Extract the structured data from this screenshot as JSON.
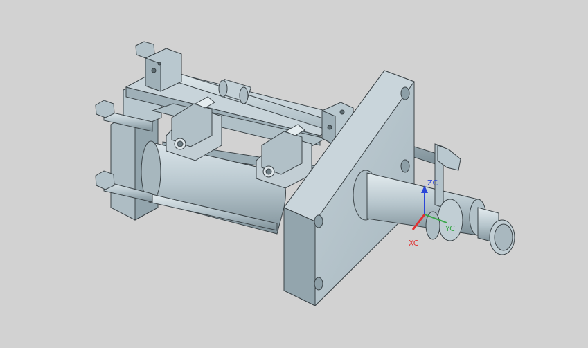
{
  "viewport": {
    "background_color": "#d2d2d2",
    "model_fill": "#b9c8cf",
    "model_shade": "#9fb0b8",
    "model_dark": "#7e9099",
    "edge_color": "#3a4246"
  },
  "triad": {
    "x_label": "XC",
    "y_label": "YC",
    "z_label": "ZC",
    "x_color": "#e03030",
    "y_color": "#3aa64a",
    "z_color": "#2c46d8"
  }
}
